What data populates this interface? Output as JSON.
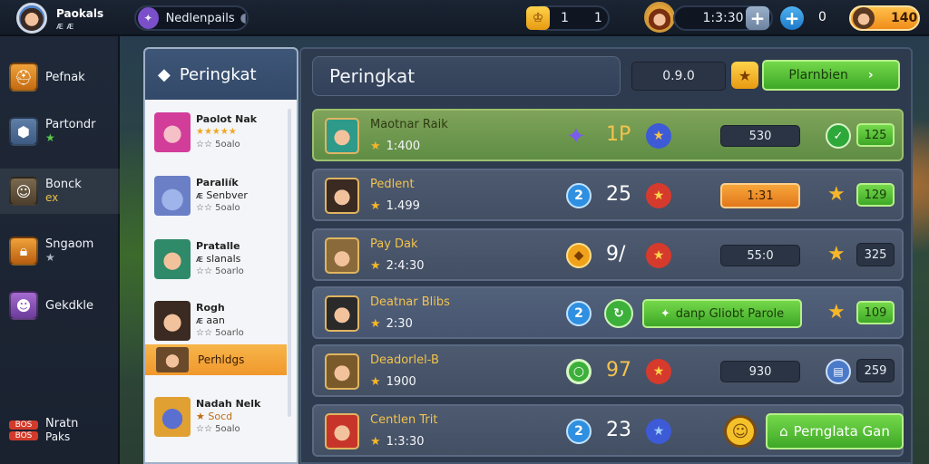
{
  "topbar": {
    "player_name": "Paokals",
    "player_sub": "ᴁ ᴁ",
    "search_text": "Nedlenpails",
    "coins_value_a": "1",
    "coins_value_b": "1",
    "timer": "1:3:30",
    "counter": "0",
    "gold": "140"
  },
  "sidebar": {
    "items": [
      {
        "label": "Pefnak",
        "sub": ""
      },
      {
        "label": "Partondr",
        "sub": "★"
      },
      {
        "label": "Bonck",
        "sub": "ex"
      },
      {
        "label": "Sngaom",
        "sub": "★"
      },
      {
        "label": "Gekdkle",
        "sub": ""
      },
      {
        "label": "Nratn",
        "sub": "Paks"
      }
    ],
    "badge_a": "BOS",
    "badge_b": "BOS"
  },
  "left_panel": {
    "title": "Peringkat",
    "entries": [
      {
        "name": "Paolot Nak",
        "stars": "★★★★★",
        "meta": "☆☆ 5oalo"
      },
      {
        "name": "Paraliík",
        "sub": "ᴁ Senbver",
        "meta": "☆☆ 5oalo"
      },
      {
        "name": "Pratalle",
        "sub": "ᴁ slanals",
        "meta": "☆☆ 5oarlo"
      },
      {
        "name": "Rogh",
        "sub": "ᴁ aan",
        "meta": "☆☆ 5oarlo"
      },
      {
        "name": "Perhldgs",
        "active": true
      },
      {
        "name": "Nadah Nelk",
        "sub": "★ Socd",
        "meta": "☆☆ 5oalo"
      }
    ]
  },
  "main": {
    "title": "Peringkat",
    "header_value": "0.9.0",
    "header_button": "Plarnbien",
    "rows": [
      {
        "name": "Maotnar Raik",
        "score": "1:400",
        "rank_text": "1P",
        "slot": "530",
        "reward": "125",
        "highlight": true
      },
      {
        "name": "Pedlent",
        "score": "1.499",
        "rank_badge": "2",
        "rank_text": "25",
        "slot": "1:31",
        "reward": "129"
      },
      {
        "name": "Pay Dak",
        "score": "2:4:30",
        "rank_text": "9/",
        "slot": "55:0",
        "reward": "325"
      },
      {
        "name": "Deatnar Blibs",
        "score": "2:30",
        "rank_badge": "2",
        "wide_button": "danp Gliobt Parole",
        "reward": "109"
      },
      {
        "name": "Deadorlel-B",
        "score": "1900",
        "rank_text": "97",
        "slot": "930",
        "reward": "259"
      },
      {
        "name": "Centlen Trit",
        "score": "1:3:30",
        "rank_badge": "2",
        "rank_text": "23",
        "wide_button": "Pernglata Gan"
      }
    ]
  },
  "colors": {
    "accent_green": "#3ea827",
    "accent_orange": "#f0982c",
    "gold_text": "#f3c34d"
  }
}
